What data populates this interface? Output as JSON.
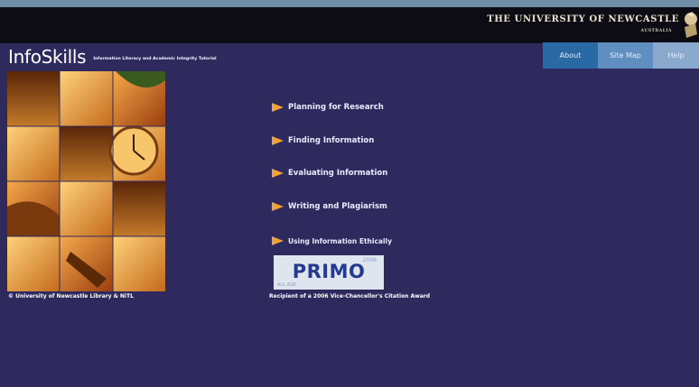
{
  "header": {
    "university": "THE UNIVERSITY OF NEWCASTLE",
    "country": "AUSTRALIA",
    "crest_icon": "university-crest-icon"
  },
  "brand": {
    "name": "InfoSkills",
    "tagline": "Information Literacy and Academic Integrity Tutorial"
  },
  "nav": [
    {
      "label": "About",
      "color": "#2a6aa4"
    },
    {
      "label": "Site Map",
      "color": "#5f8fc1"
    },
    {
      "label": "Help",
      "color": "#8aa9cc"
    }
  ],
  "menu": [
    {
      "label": "Planning for Research"
    },
    {
      "label": "Finding Information"
    },
    {
      "label": "Evaluating Information"
    },
    {
      "label": "Writing and Plagiarism"
    },
    {
      "label": "Using Information Ethically"
    }
  ],
  "menu_icon": "orange-arrow-icon",
  "primo": {
    "title": "PRIMO",
    "year": "2006",
    "footer": "ALL AGE"
  },
  "award": "Recipient of a 2006 Vice-Chancellor's Citation Award",
  "copyright": "© University of Newcastle Library & NiTL",
  "colors": {
    "background": "#2e2a5e",
    "topbar": "#0d0b14",
    "arrow": "#f2a23a"
  }
}
